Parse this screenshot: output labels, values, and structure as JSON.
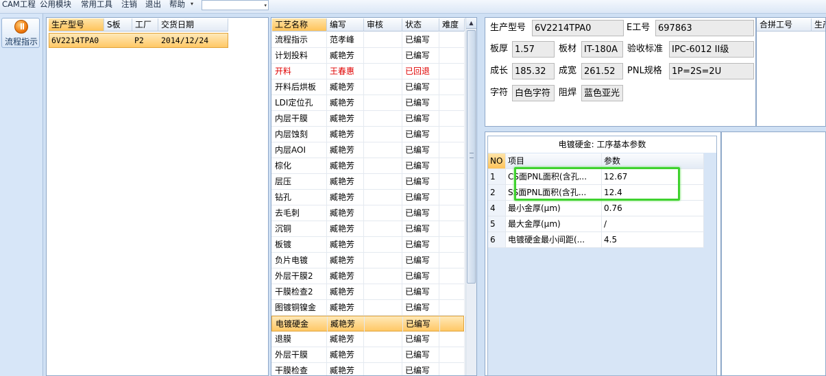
{
  "menu": {
    "items": [
      "CAM工程",
      "公用模块",
      "常用工具",
      "注销",
      "退出",
      "帮助"
    ],
    "dropdown_glyph": "▾",
    "combo_value": ""
  },
  "sidebar": {
    "flow_button_label": "流程指示"
  },
  "product_list": {
    "columns": [
      "生产型号",
      "S板",
      "工厂",
      "交货日期"
    ],
    "rows": [
      {
        "model": "6V2214TPA0",
        "s_board": "",
        "factory": "P2",
        "delivery_date": "2014/12/24"
      }
    ]
  },
  "process_list": {
    "columns": [
      "工艺名称",
      "编写",
      "审核",
      "状态",
      "难度"
    ],
    "rows": [
      {
        "name": "流程指示",
        "author": "范孝峰",
        "reviewer": "",
        "status": "已编写",
        "difficulty": ""
      },
      {
        "name": "计划投料",
        "author": "臧艳芳",
        "reviewer": "",
        "status": "已编写",
        "difficulty": ""
      },
      {
        "name": "开料",
        "author": "王春惠",
        "reviewer": "",
        "status": "已回退",
        "difficulty": ""
      },
      {
        "name": "开料后烘板",
        "author": "臧艳芳",
        "reviewer": "",
        "status": "已编写",
        "difficulty": ""
      },
      {
        "name": "LDI定位孔",
        "author": "臧艳芳",
        "reviewer": "",
        "status": "已编写",
        "difficulty": ""
      },
      {
        "name": "内层干膜",
        "author": "臧艳芳",
        "reviewer": "",
        "status": "已编写",
        "difficulty": ""
      },
      {
        "name": "内层蚀刻",
        "author": "臧艳芳",
        "reviewer": "",
        "status": "已编写",
        "difficulty": ""
      },
      {
        "name": "内层AOI",
        "author": "臧艳芳",
        "reviewer": "",
        "status": "已编写",
        "difficulty": ""
      },
      {
        "name": "棕化",
        "author": "臧艳芳",
        "reviewer": "",
        "status": "已编写",
        "difficulty": ""
      },
      {
        "name": "层压",
        "author": "臧艳芳",
        "reviewer": "",
        "status": "已编写",
        "difficulty": ""
      },
      {
        "name": "钻孔",
        "author": "臧艳芳",
        "reviewer": "",
        "status": "已编写",
        "difficulty": ""
      },
      {
        "name": "去毛刺",
        "author": "臧艳芳",
        "reviewer": "",
        "status": "已编写",
        "difficulty": ""
      },
      {
        "name": "沉铜",
        "author": "臧艳芳",
        "reviewer": "",
        "status": "已编写",
        "difficulty": ""
      },
      {
        "name": "板镀",
        "author": "臧艳芳",
        "reviewer": "",
        "status": "已编写",
        "difficulty": ""
      },
      {
        "name": "负片电镀",
        "author": "臧艳芳",
        "reviewer": "",
        "status": "已编写",
        "difficulty": ""
      },
      {
        "name": "外层干膜2",
        "author": "臧艳芳",
        "reviewer": "",
        "status": "已编写",
        "difficulty": ""
      },
      {
        "name": "干膜检查2",
        "author": "臧艳芳",
        "reviewer": "",
        "status": "已编写",
        "difficulty": ""
      },
      {
        "name": "图镀铜镍金",
        "author": "臧艳芳",
        "reviewer": "",
        "status": "已编写",
        "difficulty": ""
      },
      {
        "name": "电镀硬金",
        "author": "臧艳芳",
        "reviewer": "",
        "status": "已编写",
        "difficulty": ""
      },
      {
        "name": "退膜",
        "author": "臧艳芳",
        "reviewer": "",
        "status": "已编写",
        "difficulty": ""
      },
      {
        "name": "外层干膜",
        "author": "臧艳芳",
        "reviewer": "",
        "status": "已编写",
        "difficulty": ""
      },
      {
        "name": "干膜检查",
        "author": "臧艳芳",
        "reviewer": "",
        "status": "已编写",
        "difficulty": ""
      }
    ],
    "scroll_up_glyph": "▲"
  },
  "info": {
    "labels": {
      "model": "生产型号",
      "e_no": "E工号",
      "thickness": "板厚",
      "material": "板材",
      "standard": "验收标准",
      "length": "成长",
      "width": "成宽",
      "pnl_spec": "PNL规格",
      "legend": "字符",
      "solder_mask": "阻焊"
    },
    "values": {
      "model": "6V2214TPA0",
      "e_no": "697863",
      "thickness": "1.57",
      "material": "IT-180A",
      "standard": "IPC-6012 II级",
      "length": "185.32",
      "width": "261.52",
      "pnl_spec": "1P=2S=2U",
      "legend": "白色字符",
      "solder_mask": "蓝色亚光"
    }
  },
  "merge": {
    "columns": [
      "合拼工号",
      "生产"
    ]
  },
  "params": {
    "title": "电镀硬金: 工序基本参数",
    "columns": [
      "NO",
      "项目",
      "参数"
    ],
    "rows": [
      {
        "no": "1",
        "item": "CS面PNL面积(含孔...",
        "value": "12.67"
      },
      {
        "no": "2",
        "item": "SS面PNL面积(含孔...",
        "value": "12.4"
      },
      {
        "no": "4",
        "item": "最小金厚(μm)",
        "value": "0.76"
      },
      {
        "no": "5",
        "item": "最大金厚(μm)",
        "value": "/"
      },
      {
        "no": "6",
        "item": "电镀硬金最小间距(...",
        "value": "4.5"
      }
    ]
  },
  "colors": {
    "highlight": "#3fd22e",
    "reverted_status": "#e00000",
    "selection": "#ffc866"
  }
}
